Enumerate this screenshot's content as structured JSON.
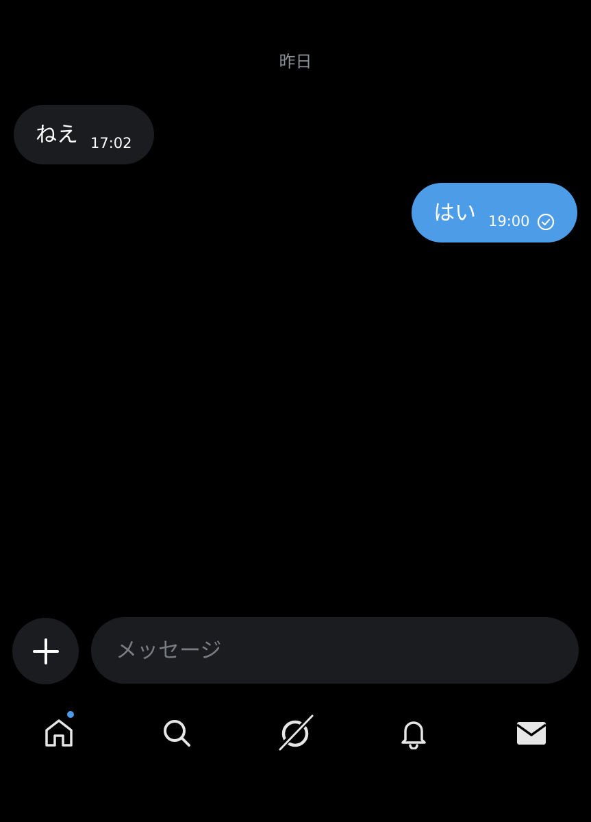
{
  "conversation": {
    "date_label": "昨日",
    "messages": [
      {
        "direction": "incoming",
        "text": "ねえ",
        "time": "17:02"
      },
      {
        "direction": "outgoing",
        "text": "はい",
        "time": "19:00",
        "status_icon": "check-circle-icon"
      }
    ]
  },
  "composer": {
    "placeholder": "メッセージ",
    "add_icon": "plus-icon"
  },
  "tab_bar": {
    "tabs": [
      {
        "icon": "home-icon",
        "badge": true
      },
      {
        "icon": "search-icon"
      },
      {
        "icon": "grok-icon"
      },
      {
        "icon": "bell-icon"
      },
      {
        "icon": "envelope-icon"
      }
    ]
  },
  "colors": {
    "background": "#000000",
    "incoming_bubble": "#1b1c1f",
    "outgoing_bubble": "#4d9ce8",
    "accent": "#4d9ce8",
    "muted_text": "#8b8e93"
  }
}
